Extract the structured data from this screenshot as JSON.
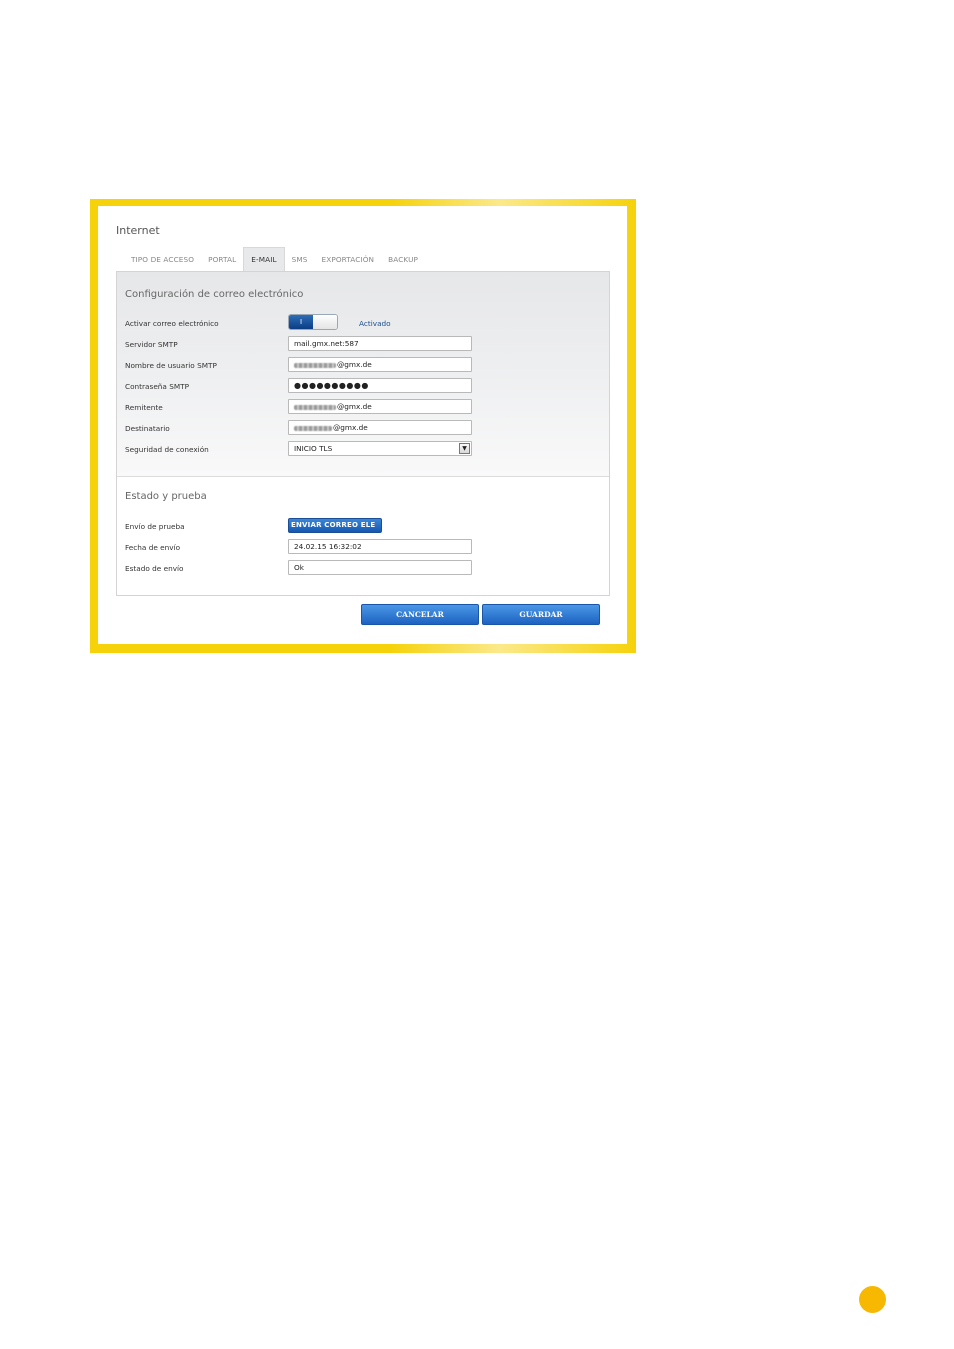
{
  "window": {
    "title": "Internet"
  },
  "tabs": [
    {
      "label": "TIPO DE ACCESO"
    },
    {
      "label": "PORTAL"
    },
    {
      "label": "E-MAIL",
      "active": true
    },
    {
      "label": "SMS"
    },
    {
      "label": "EXPORTACIÓN"
    },
    {
      "label": "BACKUP"
    }
  ],
  "email_config": {
    "title": "Configuración de correo electrónico",
    "activate": {
      "label": "Activar correo electrónico",
      "toggle_text": "I",
      "state": "Activado"
    },
    "smtp_server": {
      "label": "Servidor SMTP",
      "value": "mail.gmx.net:587"
    },
    "smtp_user": {
      "label": "Nombre de usuario SMTP",
      "value_suffix": "@gmx.de"
    },
    "smtp_password": {
      "label": "Contraseña SMTP",
      "value": "●●●●●●●●●●"
    },
    "sender": {
      "label": "Remitente",
      "value_suffix": "@gmx.de"
    },
    "recipient": {
      "label": "Destinatario",
      "value_suffix": "@gmx.de"
    },
    "security": {
      "label": "Seguridad de conexión",
      "value": "INICIO TLS"
    }
  },
  "status_test": {
    "title": "Estado y prueba",
    "test_send": {
      "label": "Envío de prueba",
      "button": "ENVIAR CORREO ELE"
    },
    "send_date": {
      "label": "Fecha de envío",
      "value": "24.02.15 16:32:02"
    },
    "send_status": {
      "label": "Estado de envío",
      "value": "Ok"
    }
  },
  "actions": {
    "cancel": "CANCELAR",
    "save": "GUARDAR"
  },
  "colors": {
    "frame": "#f6d20a",
    "accent": "#1c63c2",
    "page_dot": "#f6b800"
  }
}
